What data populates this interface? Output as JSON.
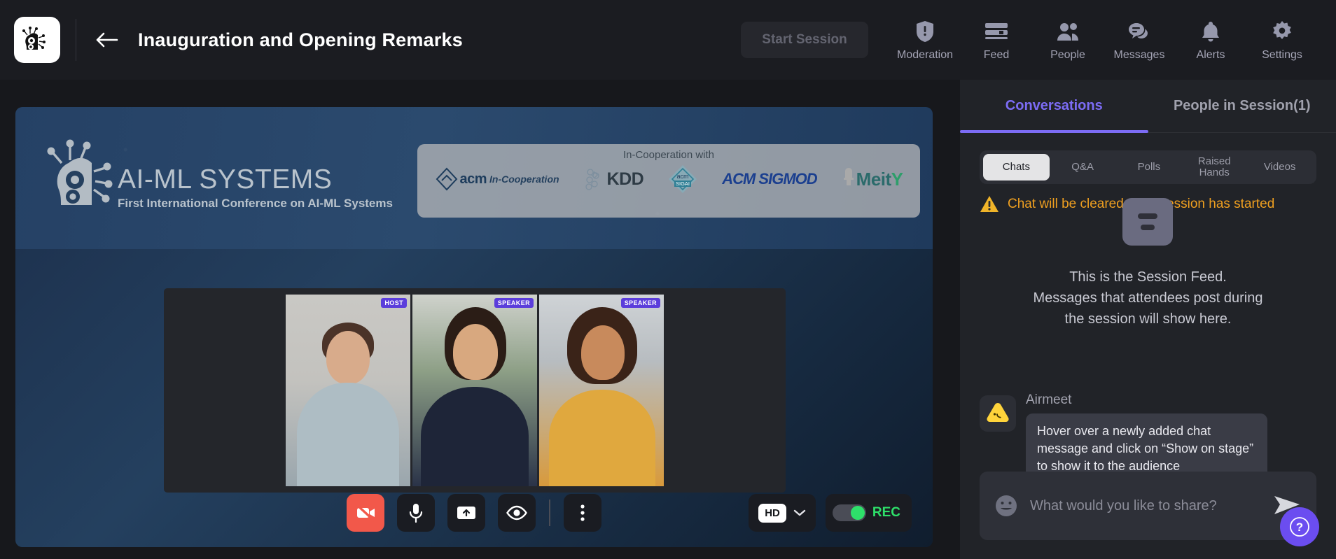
{
  "header": {
    "logo_icon": "ai-brain-circuit-logo",
    "back_icon": "back-arrow-icon",
    "title": "Inauguration and Opening Remarks",
    "start_session_label": "Start Session",
    "nav": [
      {
        "label": "Moderation",
        "icon": "shield-alert-icon"
      },
      {
        "label": "Feed",
        "icon": "feed-list-icon"
      },
      {
        "label": "People",
        "icon": "people-icon"
      },
      {
        "label": "Messages",
        "icon": "messages-icon"
      },
      {
        "label": "Alerts",
        "icon": "bell-icon"
      },
      {
        "label": "Settings",
        "icon": "gear-icon"
      }
    ]
  },
  "stage": {
    "banner": {
      "conference_title": "AI-ML SYSTEMS",
      "conference_subtitle": "First International Conference on AI-ML Systems",
      "sponsor_heading": "In-Cooperation with",
      "sponsors": [
        {
          "name": "acm",
          "tagline": "In-Cooperation"
        },
        {
          "name": "KDD",
          "tagline": ""
        },
        {
          "name": "acm",
          "tagline": "SIGAI"
        },
        {
          "name": "ACM SIGMOD",
          "tagline": ""
        },
        {
          "name": "MeitY",
          "tagline": ""
        }
      ]
    },
    "tiles": [
      {
        "badge": "HOST"
      },
      {
        "badge": "SPEAKER"
      },
      {
        "badge": "SPEAKER"
      }
    ],
    "toolbar": {
      "buttons": [
        {
          "icon": "camera-off-icon",
          "state": "off"
        },
        {
          "icon": "microphone-icon",
          "state": "on"
        },
        {
          "icon": "share-screen-icon",
          "state": "on"
        },
        {
          "icon": "eye-icon",
          "state": "on"
        },
        {
          "icon": "more-options-icon",
          "state": "on"
        }
      ],
      "quality_label": "HD",
      "quality_chevron": "chevron-down-icon",
      "rec_label": "REC",
      "rec_on": true
    }
  },
  "panel": {
    "tabs": [
      {
        "label": "Conversations",
        "active": true
      },
      {
        "label": "People in Session(1)",
        "active": false
      }
    ],
    "subtabs": [
      {
        "label": "Chats",
        "active": true
      },
      {
        "label": "Q&A",
        "active": false
      },
      {
        "label": "Polls",
        "active": false
      },
      {
        "label": "Raised Hands",
        "active": false
      },
      {
        "label": "Videos",
        "active": false
      }
    ],
    "warning": {
      "icon": "warning-triangle-icon",
      "text": "Chat will be cleared once session has started"
    },
    "empty_state": {
      "icon": "session-feed-icon",
      "line1": "This is the Session Feed.",
      "line2": "Messages that attendees post during",
      "line3": "the session will show here."
    },
    "message": {
      "avatar_icon": "airmeet-avatar-icon",
      "author": "Airmeet",
      "text": "Hover over a newly added chat message and click on “Show on stage” to show it to the audience"
    },
    "composer": {
      "emoji_icon": "emoji-smiley-icon",
      "placeholder": "What would you like to share?",
      "value": "",
      "send_icon": "send-icon"
    }
  },
  "help": {
    "icon": "question-mark-icon"
  },
  "colors": {
    "accent_purple": "#7c6cf5",
    "warning_orange": "#f0a020",
    "danger_red": "#f2584a",
    "rec_green": "#2ee06a",
    "badge_purple": "#5b3ddb"
  }
}
